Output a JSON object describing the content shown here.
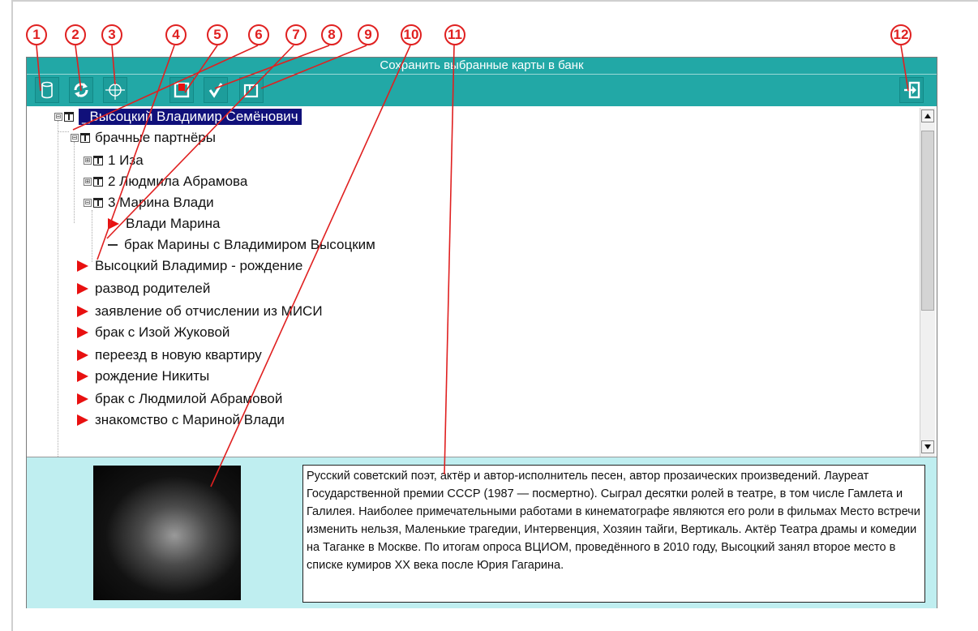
{
  "window": {
    "title": "Сохранить выбранные карты в банк"
  },
  "callouts": [
    "1",
    "2",
    "3",
    "4",
    "5",
    "6",
    "7",
    "8",
    "9",
    "10",
    "11",
    "12"
  ],
  "toolbar": {
    "buttons": [
      {
        "name": "database-icon"
      },
      {
        "name": "refresh-icon"
      },
      {
        "name": "target-icon"
      },
      {
        "name": "save-card-icon"
      },
      {
        "name": "checkmark-icon"
      },
      {
        "name": "save-selected-icon"
      },
      {
        "name": "exit-icon"
      }
    ]
  },
  "tree": {
    "root": "_Высоцкий Владимир Семёнович",
    "partners": "брачные партнёры",
    "partner1": "1 Иза",
    "partner2": "2 Людмила Абрамова",
    "partner3": "3 Марина Влади",
    "partner3_child1": "Влади Марина",
    "partner3_child2": "брак Марины с Владимиром Высоцким",
    "events": [
      "Высоцкий Владимир - рождение",
      "развод родителей",
      "заявление об отчислении из МИСИ",
      "брак с Изой Жуковой",
      "переезд в новую квартиру",
      "рождение Никиты",
      "брак с Людмилой Абрамовой",
      "знакомство с Мариной Влади"
    ]
  },
  "description": "Русский советский поэт, актёр и автор-исполнитель песен, автор прозаических произведений. Лауреат Государственной премии СССР (1987 — посмертно). Сыграл десятки ролей в театре, в том числе Гамлета и Галилея. Наиболее примечательными работами в кинематографе являются его роли в фильмах Место встречи изменить нельзя, Маленькие трагедии, Интервенция, Хозяин тайги, Вертикаль. Актёр Театра драмы и комедии на Таганке в Москве.  По итогам опроса ВЦИОМ, проведённого в 2010 году, Высоцкий занял второе место в списке кумиров XX века после Юрия Гагарина.",
  "colors": {
    "accent": "#22a8a6",
    "callout": "#e02020",
    "selection": "#10107a",
    "panel": "#bfeef0"
  }
}
